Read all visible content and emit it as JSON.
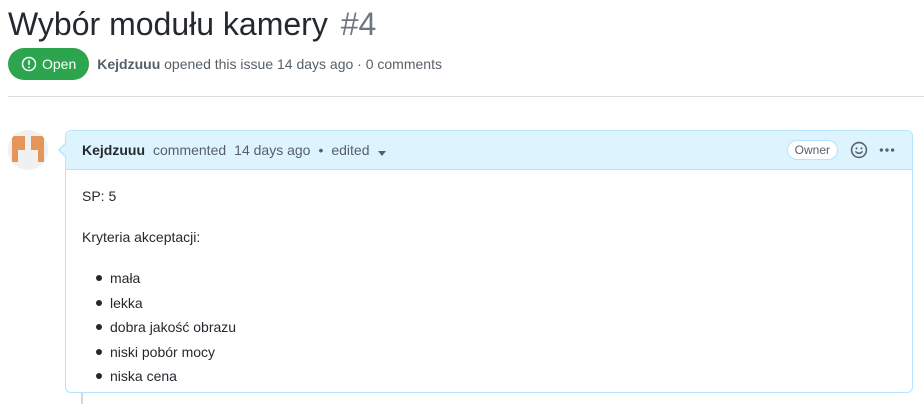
{
  "issue": {
    "title": "Wybór modułu kamery",
    "number": "#4",
    "state": "Open",
    "author": "Kejdzuuu",
    "opened_text": "opened this issue 14 days ago · 0 comments"
  },
  "comment": {
    "author": "Kejdzuuu",
    "action": "commented",
    "time": "14 days ago",
    "bullet_sep": "•",
    "edited": "edited",
    "role_badge": "Owner",
    "sp_line": "SP: 5",
    "criteria_heading": "Kryteria akceptacji:",
    "criteria": [
      "mała",
      "lekka",
      "dobra jakość obrazu",
      "niski pobór mocy",
      "niska cena"
    ]
  },
  "icons": {
    "state": "issue-opened-icon",
    "reaction": "smiley-icon",
    "menu": "kebab-horizontal-icon",
    "edited_dropdown": "triangle-down-icon"
  },
  "colors": {
    "open_green": "#2da44e",
    "header_blue": "#ddf4ff",
    "border_blue": "#b6e3ff",
    "avatar_orange": "#e6955a"
  }
}
